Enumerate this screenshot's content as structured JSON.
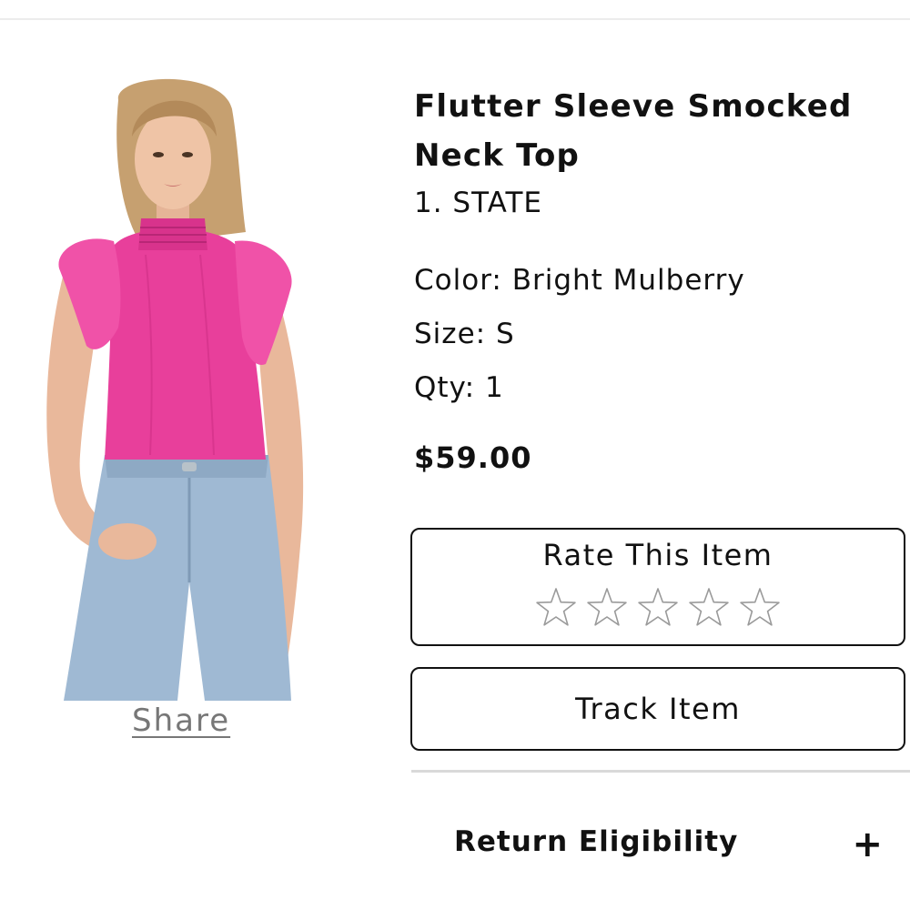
{
  "product": {
    "title": "Flutter Sleeve Smocked Neck Top",
    "brand": "1. STATE",
    "attributes": [
      {
        "label": "Color:",
        "value": "Bright Mulberry"
      },
      {
        "label": "Size:",
        "value": "S"
      },
      {
        "label": "Qty:",
        "value": "1"
      }
    ],
    "price": "$59.00",
    "image_color": "#e83f9b"
  },
  "share": {
    "label": "Share"
  },
  "rating": {
    "title": "Rate This Item",
    "max_stars": 5,
    "current_rating": 0
  },
  "track": {
    "label": "Track Item"
  },
  "return_section": {
    "label": "Return Eligibility",
    "expand_icon": "+"
  },
  "colors": {
    "text": "#111111",
    "muted": "#777777",
    "divider": "#d9d9d9",
    "star_outline": "#9a9a9a"
  }
}
